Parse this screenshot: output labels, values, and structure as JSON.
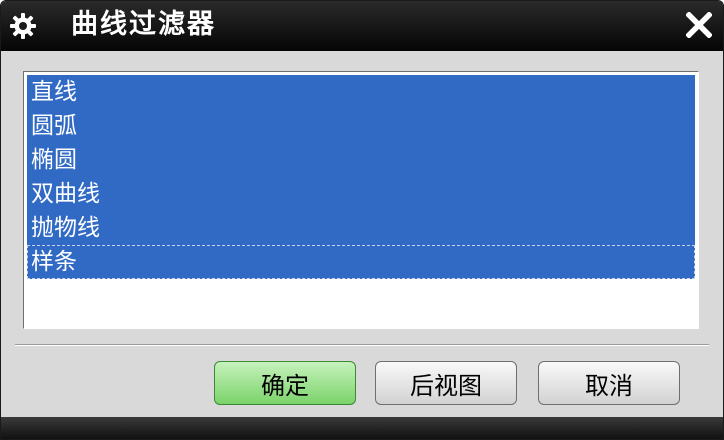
{
  "window": {
    "title": "曲线过滤器"
  },
  "icons": {
    "title": "gear-icon",
    "close": "close-icon"
  },
  "list": {
    "items": [
      {
        "label": "直线",
        "selected": true
      },
      {
        "label": "圆弧",
        "selected": true
      },
      {
        "label": "椭圆",
        "selected": true
      },
      {
        "label": "双曲线",
        "selected": true
      },
      {
        "label": "抛物线",
        "selected": true
      },
      {
        "label": "样条",
        "selected": true
      }
    ]
  },
  "buttons": {
    "ok": "确定",
    "back_view": "后视图",
    "cancel": "取消"
  },
  "colors": {
    "selection": "#316ac5",
    "ok_button": "#7bd36a",
    "titlebar": "#000000"
  }
}
